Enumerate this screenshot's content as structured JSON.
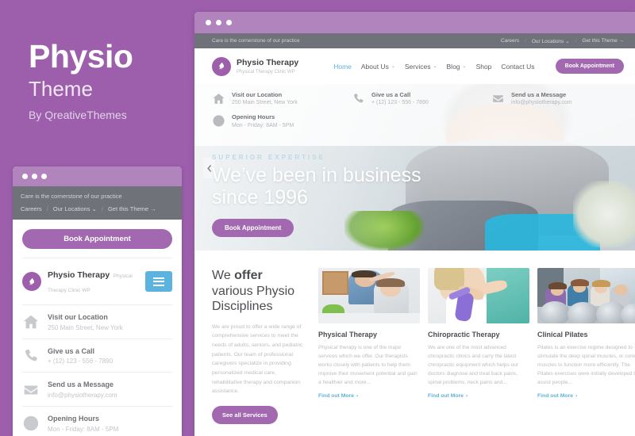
{
  "promo": {
    "title": "Physio",
    "subtitle": "Theme",
    "byline": "By QreativeThemes"
  },
  "colors": {
    "background_purple": "#9d5fac",
    "brand_purple": "#a269b0",
    "accent_blue": "#5bb3de",
    "topbar_gray": "#6f7278",
    "chrome_purple": "#b184bd"
  },
  "site": {
    "brand_name": "Physio Therapy",
    "brand_tagline": "Physical Therapy Clinic WP",
    "logo_icon": "leaf-icon",
    "topbar": {
      "tagline": "Care is the cornerstone of our practice",
      "links": [
        {
          "label": "Careers"
        },
        {
          "label": "Our Locations",
          "caret": "⌄"
        },
        {
          "label": "Get this Theme →"
        }
      ]
    },
    "menu": [
      {
        "label": "Home",
        "active": true
      },
      {
        "label": "About Us",
        "caret": "⌄"
      },
      {
        "label": "Services",
        "caret": "⌄"
      },
      {
        "label": "Blog",
        "caret": "⌄"
      },
      {
        "label": "Shop"
      },
      {
        "label": "Contact Us"
      }
    ],
    "book_button": "Book Appointment",
    "contact_info": [
      {
        "icon": "home-icon",
        "title": "Visit our Location",
        "value": "250 Main Street, New York"
      },
      {
        "icon": "phone-icon",
        "title": "Give us a Call",
        "value": "+ (12) 123 - 556 - 7890"
      },
      {
        "icon": "envelope-icon",
        "title": "Send us a Message",
        "value": "info@physiotherapy.com"
      },
      {
        "icon": "clock-icon",
        "title": "Opening Hours",
        "value": "Mon - Friday: 8AM - 5PM"
      }
    ]
  },
  "hero": {
    "eyebrow": "SUPERIOR EXPERTISE",
    "heading": "We’ve been in business since 1996",
    "button": "Book Appointment",
    "prev_arrow": "◀"
  },
  "services": {
    "heading_plain": "We ",
    "heading_bold": "offer",
    "heading_rest": " various Physio Disciplines",
    "paragraph": "We are proud to offer a wide range of comprehensive services to meet the needs of adults, seniors, and pediatric patients. Our team of professional caregivers specialize in providing personalized medical care, rehabilitative therapy and companion assistance.",
    "button": "See all Services",
    "cards": [
      {
        "title": "Physical Therapy",
        "text": "Physical therapy is one of the major services which we offer. Our therapists works closely with patients to help them improve their movement potential and gain a healthier and more...",
        "link": "Find out More",
        "image_alt": "therapist-stretching-patient-arm"
      },
      {
        "title": "Chiropractic Therapy",
        "text": "We are one of the most advanced chiropractic clinics and carry the latest chiropractic equipment which helps our doctors diagnose and treat back pains, spinal problems, neck pains and...",
        "link": "Find out More",
        "image_alt": "resistance-band-exercise"
      },
      {
        "title": "Clinical Pilates",
        "text": "Pilates is an exercise regime designed to stimulate the deep spinal muscles, or core muscles to function more efficiently. The Pilates exercises were initially developed to assist people...",
        "link": "Find out More",
        "image_alt": "group-pilates-with-exercise-balls"
      }
    ],
    "link_chevron": "›"
  }
}
